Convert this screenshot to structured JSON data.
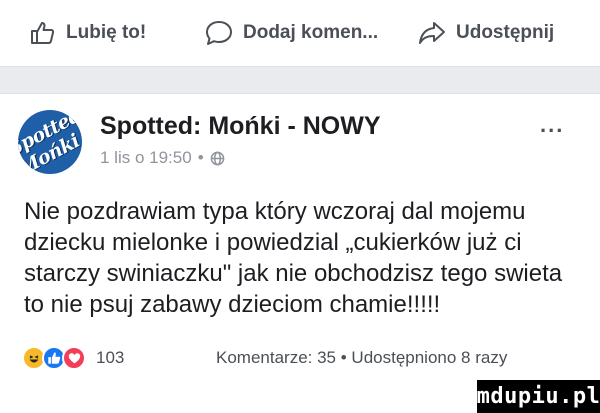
{
  "actions": {
    "like_label": "Lubię to!",
    "comment_label": "Dodaj komen...",
    "share_label": "Udostępnij"
  },
  "post": {
    "avatar_text": "Spotted Mońki",
    "author": "Spotted: Mońki - NOWY",
    "timestamp": "1 lis o 19:50",
    "audience_icon": "globe-icon",
    "more_label": "...",
    "text": "Nie pozdrawiam typa który wczoraj dal mojemu dziecku mielonke i powiedzial „cukierków już ci starczy swiniaczku\" jak nie obchodzisz tego swieta to nie psuj zabawy dzieciom chamie!!!!!"
  },
  "reactions": {
    "icons": [
      "haha-reaction-icon",
      "like-reaction-icon",
      "love-reaction-icon"
    ],
    "count": "103",
    "stats": "Komentarze: 35 • Udostępniono 8 razy"
  },
  "watermark": {
    "text": "mdupiu.pl"
  },
  "colors": {
    "text": "#1c1e21",
    "secondary": "#90949c",
    "action": "#4b4f56",
    "like_blue": "#1877f2",
    "love_red": "#f33e58",
    "haha_yellow": "#f7b928",
    "separator": "#e9ebee"
  }
}
